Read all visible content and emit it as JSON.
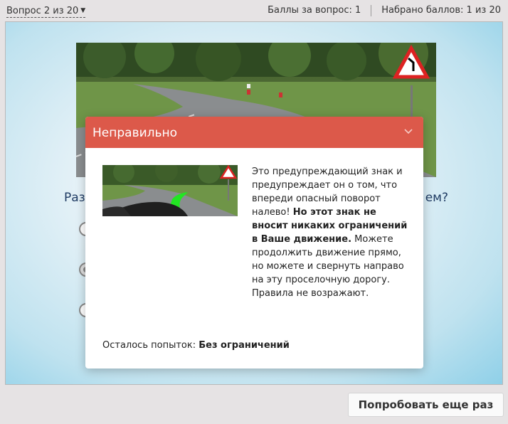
{
  "topbar": {
    "question_nav": "Вопрос 2 из 20",
    "points_per_question": "Баллы за вопрос: 1",
    "points_total": "Набрано баллов: 1 из 20"
  },
  "question": {
    "text_left": "Раз",
    "text_right": "ем?"
  },
  "feedback": {
    "title": "Неправильно",
    "text_part1": "Это предупреждающий знак и предупреждает он о том, что впереди опасный поворот налево! ",
    "text_bold": "Но этот знак не вносит никаких ограничений в Ваше движение.",
    "text_part2": " Можете продолжить движение прямо, но можете и свернуть направо на эту проселочную дорогу. Правила не возражают.",
    "attempts_label": "Осталось попыток: ",
    "attempts_value": "Без ограничений",
    "header_color": "#dc594a"
  },
  "buttons": {
    "retry": "Попробовать еще раз"
  },
  "icons": {
    "nav_caret": "caret-down-icon",
    "collapse": "chevron-down-icon",
    "road_sign": "left-curve-warning-sign"
  }
}
